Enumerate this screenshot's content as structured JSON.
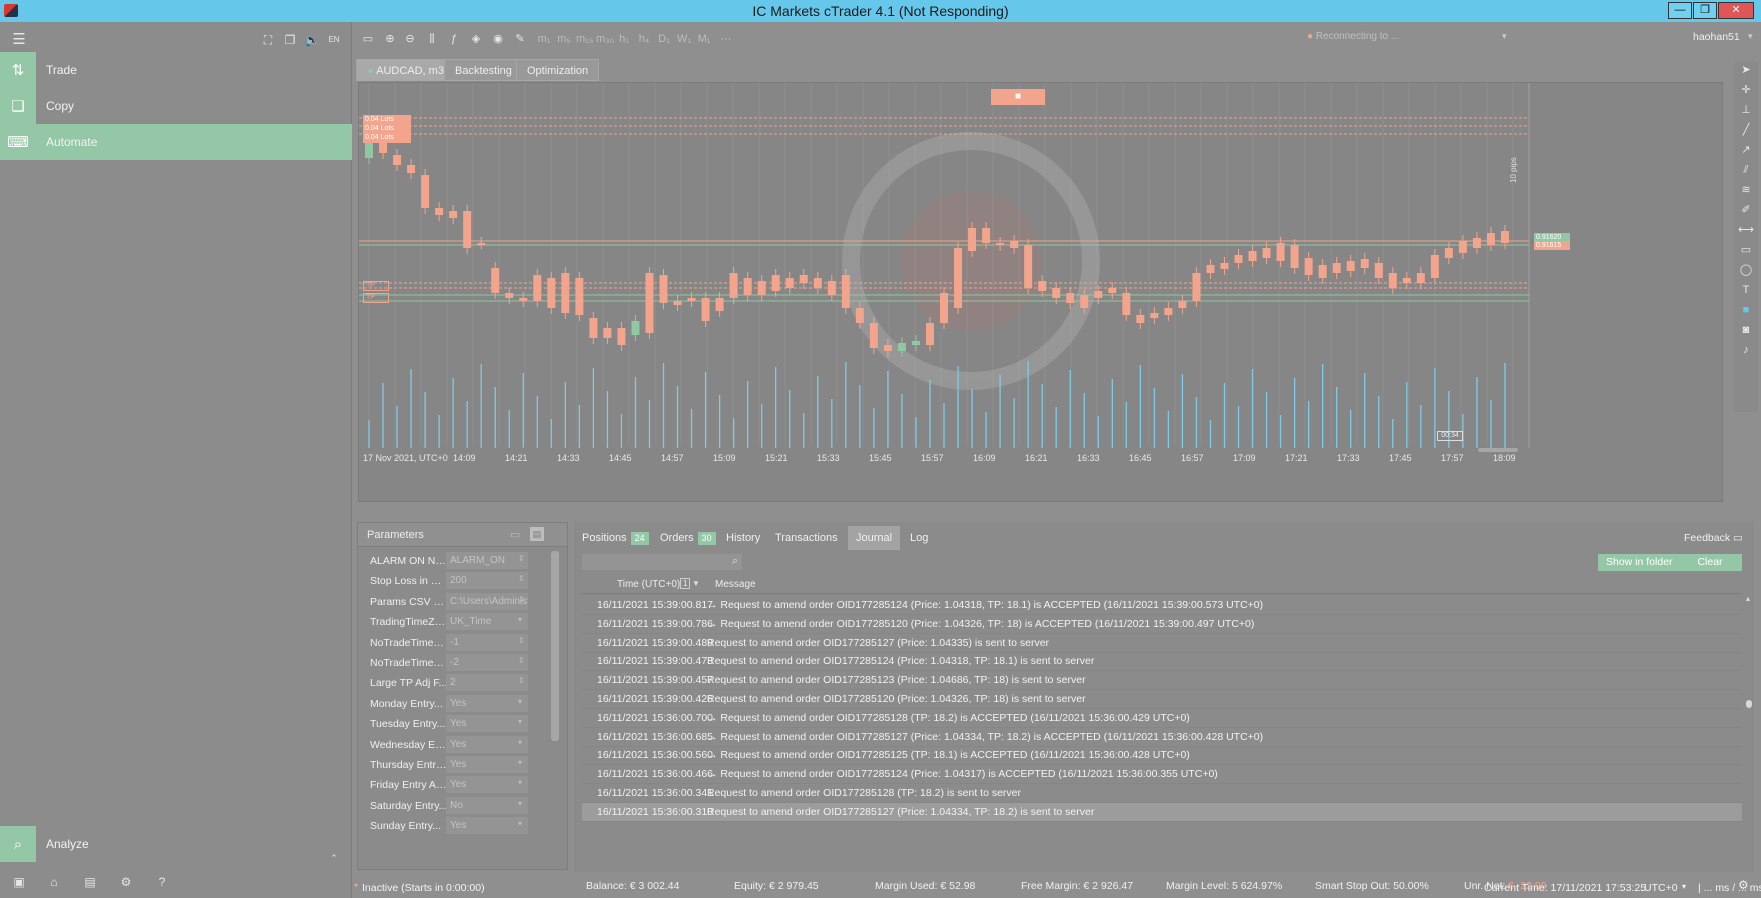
{
  "window": {
    "title": "IC Markets cTrader 4.1 (Not Responding)",
    "controls": [
      "minimize",
      "restore",
      "close"
    ]
  },
  "sidebar": {
    "items": [
      {
        "label": "Trade",
        "icon": "trade-icon"
      },
      {
        "label": "Copy",
        "icon": "copy-icon"
      },
      {
        "label": "Automate",
        "icon": "automate-icon",
        "active": true
      }
    ],
    "analyze_label": "Analyze"
  },
  "header": {
    "connection_status": "Reconnecting to ...",
    "username": "haohan51"
  },
  "chart_tabs": [
    {
      "label": "AUDCAD, m3",
      "active": true
    },
    {
      "label": "Backtesting"
    },
    {
      "label": "Optimization"
    }
  ],
  "chart": {
    "stop_label": "■",
    "order_tags": [
      "0.04 Lots",
      "0.04 Lots",
      "0.04 Lots"
    ],
    "tp_tags": [
      "TP",
      "TP"
    ],
    "pips_label": "10 pips",
    "price_tags": [
      "0.91620",
      "0.91615"
    ],
    "time_labels": [
      "17 Nov 2021, UTC+0",
      "14:09",
      "14:21",
      "14:33",
      "14:45",
      "14:57",
      "15:09",
      "15:21",
      "15:33",
      "15:45",
      "15:57",
      "16:09",
      "16:21",
      "16:33",
      "16:45",
      "16:57",
      "17:09",
      "17:21",
      "17:33",
      "17:45",
      "17:57",
      "18:09"
    ],
    "countdown": "00:34",
    "bull_color": "#8fc8a2",
    "bear_color": "#f2a48c"
  },
  "parameters": {
    "title": "Parameters",
    "rows": [
      {
        "name": "ALARM ON Name",
        "value": "ALARM_ON"
      },
      {
        "name": "Stop Loss in Pips",
        "value": "200"
      },
      {
        "name": "Params CSV Fil...",
        "value": "C:\\Users\\Administr"
      },
      {
        "name": "TradingTimeZone",
        "value": "UK_Time"
      },
      {
        "name": "NoTradeTimeSt...",
        "value": "-1"
      },
      {
        "name": "NoTradeTimeE...",
        "value": "-2"
      },
      {
        "name": "Large TP Adj F...",
        "value": "2"
      },
      {
        "name": "Monday Entry...",
        "value": "Yes"
      },
      {
        "name": "Tuesday Entry...",
        "value": "Yes"
      },
      {
        "name": "Wednesday En...",
        "value": "Yes"
      },
      {
        "name": "Thursday Entry...",
        "value": "Yes"
      },
      {
        "name": "Friday Entry All...",
        "value": "Yes"
      },
      {
        "name": "Saturday Entry...",
        "value": "No"
      },
      {
        "name": "Sunday Entry...",
        "value": "Yes"
      }
    ]
  },
  "bottom_tabs": [
    {
      "label": "Positions",
      "badge": "24"
    },
    {
      "label": "Orders",
      "badge": "30"
    },
    {
      "label": "History"
    },
    {
      "label": "Transactions"
    },
    {
      "label": "Journal",
      "active": true
    },
    {
      "label": "Log"
    }
  ],
  "feedback_label": "Feedback",
  "journal": {
    "show_in_folder": "Show in folder",
    "clear": "Clear",
    "col_time": "Time (UTC+0)",
    "col_time_badge": "1",
    "col_message": "Message",
    "rows": [
      {
        "time": "16/11/2021 15:39:00.817",
        "msg": "→ Request to amend order OID177285124 (Price: 1.04318, TP: 18.1) is ACCEPTED (16/11/2021 15:39:00.573 UTC+0)"
      },
      {
        "time": "16/11/2021 15:39:00.786",
        "msg": "→ Request to amend order OID177285120 (Price: 1.04326, TP: 18) is ACCEPTED (16/11/2021 15:39:00.497 UTC+0)"
      },
      {
        "time": "16/11/2021 15:39:00.489",
        "msg": "Request to amend order OID177285127 (Price: 1.04335) is sent to server"
      },
      {
        "time": "16/11/2021 15:39:00.473",
        "msg": "Request to amend order OID177285124 (Price: 1.04318, TP: 18.1) is sent to server"
      },
      {
        "time": "16/11/2021 15:39:00.457",
        "msg": "Request to amend order OID177285123 (Price: 1.04686, TP: 18) is sent to server"
      },
      {
        "time": "16/11/2021 15:39:00.426",
        "msg": "Request to amend order OID177285120 (Price: 1.04326, TP: 18) is sent to server"
      },
      {
        "time": "16/11/2021 15:36:00.700",
        "msg": "→ Request to amend order OID177285128 (TP: 18.2) is ACCEPTED (16/11/2021 15:36:00.429 UTC+0)"
      },
      {
        "time": "16/11/2021 15:36:00.685",
        "msg": "→ Request to amend order OID177285127 (Price: 1.04334, TP: 18.2) is ACCEPTED (16/11/2021 15:36:00.428 UTC+0)"
      },
      {
        "time": "16/11/2021 15:36:00.560",
        "msg": "→ Request to amend order OID177285125 (TP: 18.1) is ACCEPTED (16/11/2021 15:36:00.428 UTC+0)"
      },
      {
        "time": "16/11/2021 15:36:00.466",
        "msg": "→ Request to amend order OID177285124 (Price: 1.04317) is ACCEPTED (16/11/2021 15:36:00.355 UTC+0)"
      },
      {
        "time": "16/11/2021 15:36:00.341",
        "msg": "Request to amend order OID177285128 (TP: 18.2) is sent to server"
      },
      {
        "time": "16/11/2021 15:36:00.310",
        "msg": "Request to amend order OID177285127 (Price: 1.04334, TP: 18.2) is sent to server"
      }
    ]
  },
  "account": {
    "balance": "Balance: € 3 002.44",
    "equity": "Equity: € 2 979.45",
    "margin_used": "Margin Used: € 52.98",
    "free_margin": "Free Margin: € 2 926.47",
    "margin_level": "Margin Level: 5 624.97%",
    "smart_stop_out": "Smart Stop Out: 50.00%",
    "unr_net_label": "Unr. Net:",
    "unr_net_value": "€ -22.99"
  },
  "status": {
    "cbot_status": "Inactive (Starts in 0:00:00)",
    "current_time": "Current Time: 17/11/2021 17:53:25",
    "timezone": "UTC+0",
    "latency": "| ... ms / ... ms"
  }
}
